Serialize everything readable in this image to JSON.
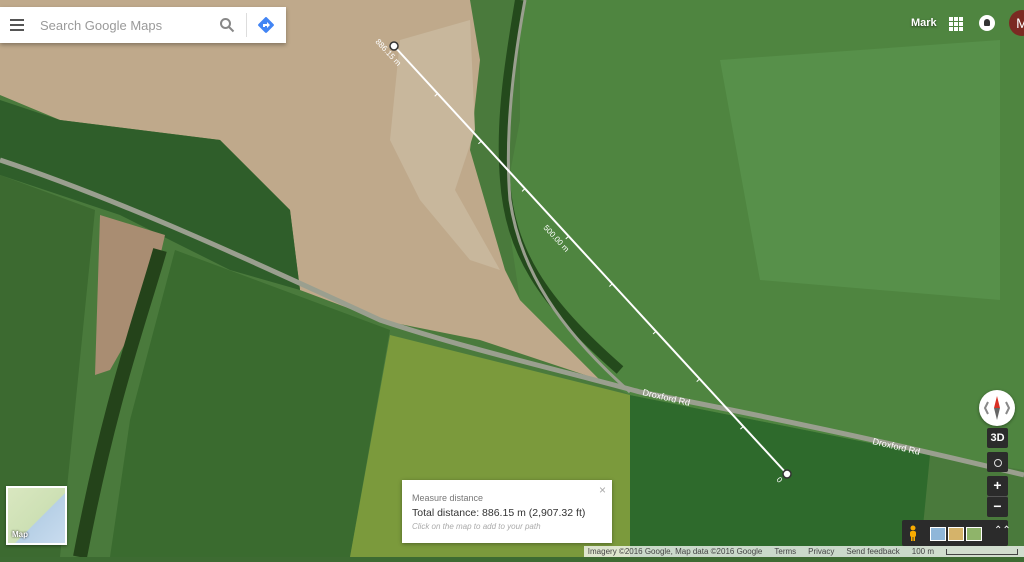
{
  "search": {
    "placeholder": "Search Google Maps"
  },
  "account": {
    "name": "Mark",
    "avatar_initial": "M"
  },
  "measure": {
    "start_label": "886.15 m",
    "mid_label": "500.00 m",
    "end_label": "0",
    "card_title": "Measure distance",
    "total": "Total distance: 886.15 m (2,907.32 ft)",
    "hint": "Click on the map to add to your path",
    "close": "×"
  },
  "roads": {
    "label1": "Droxford Rd",
    "label2": "Droxford Rd"
  },
  "controls": {
    "view3d": "3D",
    "zoom_in": "+",
    "zoom_out": "−",
    "expand": "⌃⌃"
  },
  "minimap": {
    "label": "Map"
  },
  "footer": {
    "attribution": "Imagery ©2016 Google, Map data ©2016 Google",
    "terms": "Terms",
    "privacy": "Privacy",
    "feedback": "Send feedback",
    "scale": "100 m"
  },
  "icons": [
    "menu-icon",
    "search-icon",
    "directions-icon",
    "apps-icon",
    "notifications-icon",
    "compass-icon",
    "pegman-icon"
  ]
}
